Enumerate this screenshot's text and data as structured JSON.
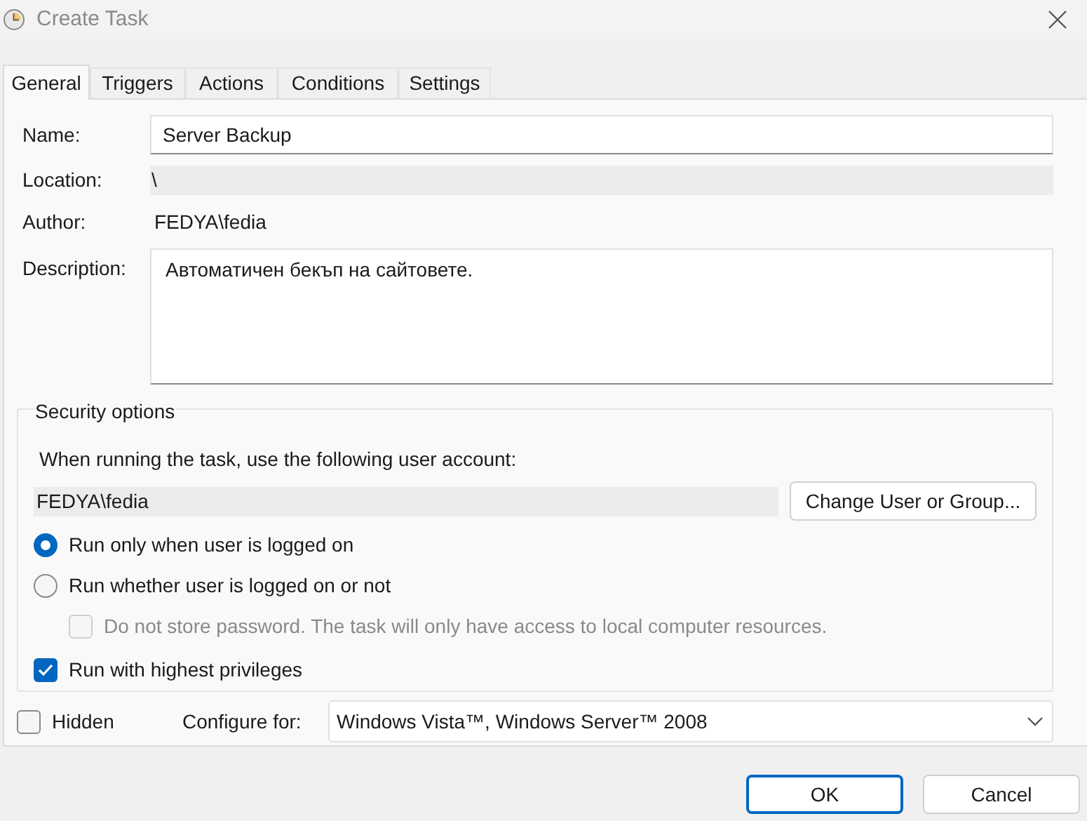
{
  "window": {
    "title": "Create Task"
  },
  "tabs": [
    {
      "label": "General",
      "selected": true
    },
    {
      "label": "Triggers",
      "selected": false
    },
    {
      "label": "Actions",
      "selected": false
    },
    {
      "label": "Conditions",
      "selected": false
    },
    {
      "label": "Settings",
      "selected": false
    }
  ],
  "general": {
    "name": {
      "label": "Name:",
      "value": "Server Backup"
    },
    "location": {
      "label": "Location:",
      "value": "\\"
    },
    "author": {
      "label": "Author:",
      "value": "FEDYA\\fedia"
    },
    "description": {
      "label": "Description:",
      "value": "Автоматичен бекъп на сайтовете."
    }
  },
  "security": {
    "title": "Security options",
    "account_prompt": "When running the task, use the following user account:",
    "account": "FEDYA\\fedia",
    "change_button": "Change User or Group...",
    "options": [
      {
        "kind": "radio",
        "label": "Run only when user is logged on",
        "selected": true,
        "disabled": false
      },
      {
        "kind": "radio",
        "label": "Run whether user is logged on or not",
        "selected": false,
        "disabled": false
      },
      {
        "kind": "checkbox",
        "label": "Do not store password.  The task will only have access to local computer resources.",
        "checked": false,
        "disabled": true
      },
      {
        "kind": "checkbox",
        "label": "Run with highest privileges",
        "checked": true,
        "disabled": false
      }
    ]
  },
  "hidden": {
    "label": "Hidden",
    "checked": false
  },
  "configure": {
    "label": "Configure for:",
    "value": "Windows Vista™, Windows Server™ 2008"
  },
  "buttons": [
    {
      "label": "OK",
      "default": true
    },
    {
      "label": "Cancel",
      "default": false
    }
  ]
}
